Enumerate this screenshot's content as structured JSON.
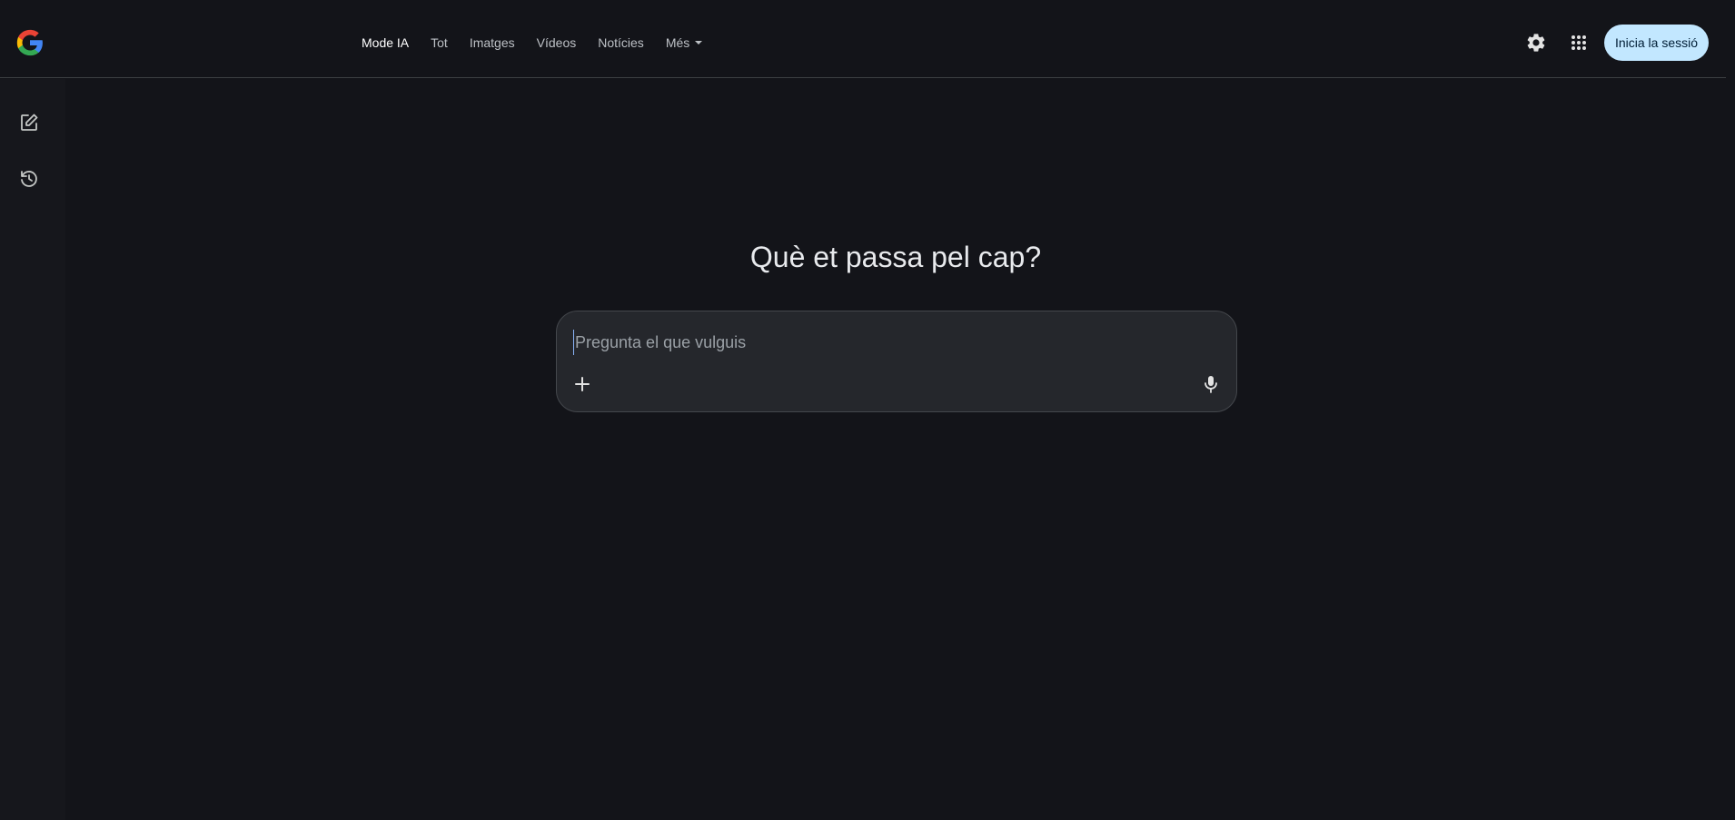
{
  "header": {
    "logo": "google-g-logo",
    "nav": [
      {
        "label": "Mode IA",
        "active": true
      },
      {
        "label": "Tot",
        "active": false
      },
      {
        "label": "Imatges",
        "active": false
      },
      {
        "label": "Vídeos",
        "active": false
      },
      {
        "label": "Notícies",
        "active": false
      },
      {
        "label": "Més",
        "active": false,
        "dropdown": true
      }
    ],
    "settings_icon": "gear-icon",
    "apps_icon": "apps-grid-icon",
    "signin_label": "Inicia la sessió"
  },
  "sidebar": {
    "items": [
      {
        "icon": "new-chat-edit-icon"
      },
      {
        "icon": "history-icon"
      }
    ]
  },
  "main": {
    "title": "Què et passa pel cap?",
    "search": {
      "placeholder": "Pregunta el que vulguis",
      "value": "",
      "add_icon": "plus-icon",
      "mic_icon": "mic-icon"
    }
  },
  "colors": {
    "background": "#131419",
    "signin_bg": "#c2e7ff",
    "searchbox_bg": "#25272c"
  }
}
